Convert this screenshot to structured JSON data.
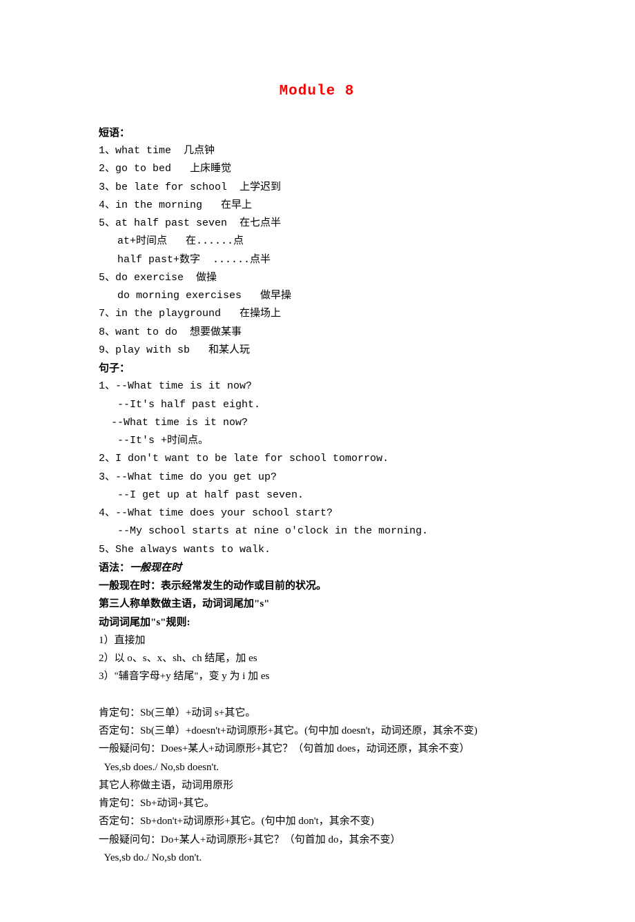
{
  "title": "Module 8",
  "phrases_label": "短语：",
  "phrases": [
    "1、what time  几点钟",
    "2、go to bed   上床睡觉",
    "3、be late for school  上学迟到",
    "4、in the morning   在早上",
    "5、at half past seven  在七点半",
    "   at+时间点   在......点",
    "   half past+数字  ......点半",
    "5、do exercise  做操",
    "   do morning exercises   做早操",
    "7、in the playground   在操场上",
    "8、want to do  想要做某事",
    "9、play with sb   和某人玩"
  ],
  "sentences_label": "句子：",
  "sentences": [
    "1、--What time is it now?",
    "   --It's half past eight.",
    "  --What time is it now?",
    "   --It's +时间点。",
    "2、I don't want to be late for school tomorrow.",
    "3、--What time do you get up?",
    "   --I get up at half past seven.",
    "4、--What time does your school start?",
    "   --My school starts at nine o'clock in the morning.",
    "5、She always wants to walk."
  ],
  "grammar_label": "语法：",
  "grammar_title": "一般现在时",
  "grammar_lines": [
    "一般现在时：表示经常发生的动作或目前的状况。",
    "第三人称单数做主语，动词词尾加\"s\"",
    "动词词尾加\"s\"规则:",
    "1）直接加",
    "2）以 o、s、x、sh、ch 结尾，加 es",
    "3）\"辅音字母+y 结尾\"，变 y 为 i 加 es"
  ],
  "grammar_block2": [
    "肯定句：Sb(三单）+动词 s+其它。",
    "否定句：Sb(三单）+doesn't+动词原形+其它。(句中加 doesn't，动词还原，其余不变)",
    "一般疑问句：Does+某人+动词原形+其它？（句首加 does，动词还原，其余不变）",
    "  Yes,sb does./ No,sb doesn't.",
    "其它人称做主语，动词用原形",
    "肯定句：Sb+动词+其它。",
    "否定句：Sb+don't+动词原形+其它。(句中加 don't，其余不变)",
    "一般疑问句：Do+某人+动词原形+其它？（句首加 do，其余不变）",
    "  Yes,sb do./ No,sb don't."
  ]
}
